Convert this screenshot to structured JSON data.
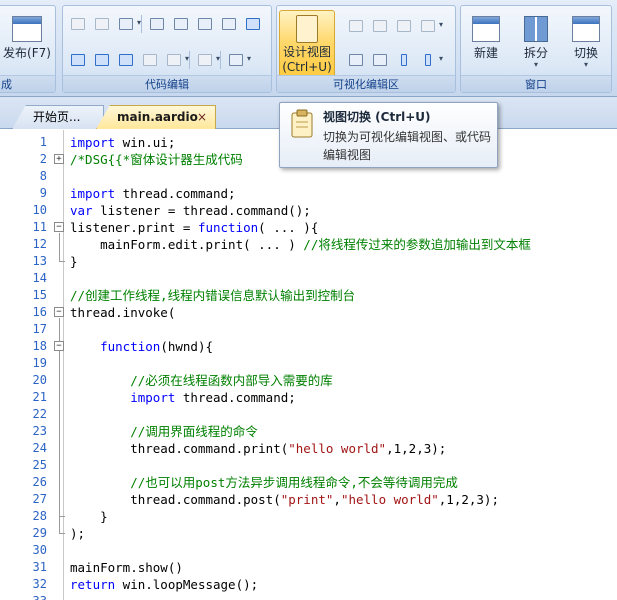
{
  "ribbon": {
    "groups": [
      {
        "title": "成"
      },
      {
        "title": "代码编辑"
      },
      {
        "title": "可视化编辑区"
      },
      {
        "title": "窗口"
      }
    ],
    "publish_label": "发布(F7)",
    "design_view_label": "设计视图",
    "design_view_shortcut": "(Ctrl+U)",
    "new_label": "新建",
    "split_label": "拆分",
    "switch_label": "切换"
  },
  "tabs": [
    {
      "label": "开始页..."
    },
    {
      "label": "main.aardio",
      "close": "×"
    }
  ],
  "tooltip": {
    "title": "视图切换 (Ctrl+U)",
    "description": "切换为可视化编辑视图、或代码编辑视图"
  },
  "editor": {
    "lines": [
      {
        "num": "1",
        "text": "import win.ui;"
      },
      {
        "num": "2",
        "text": "/*DSG{{*窗体设计器生成代码"
      },
      {
        "num": "8",
        "text": ""
      },
      {
        "num": "9",
        "text": "import thread.command;"
      },
      {
        "num": "10",
        "text": "var listener = thread.command();"
      },
      {
        "num": "11",
        "text": "listener.print = function( ... ){"
      },
      {
        "num": "12",
        "text": "    mainForm.edit.print( ... ) //将线程传过来的参数追加输出到文本框"
      },
      {
        "num": "13",
        "text": "}"
      },
      {
        "num": "14",
        "text": ""
      },
      {
        "num": "15",
        "text": "//创建工作线程,线程内错误信息默认输出到控制台"
      },
      {
        "num": "16",
        "text": "thread.invoke("
      },
      {
        "num": "17",
        "text": ""
      },
      {
        "num": "18",
        "text": "    function(hwnd){"
      },
      {
        "num": "19",
        "text": ""
      },
      {
        "num": "20",
        "text": "        //必须在线程函数内部导入需要的库"
      },
      {
        "num": "21",
        "text": "        import thread.command;"
      },
      {
        "num": "22",
        "text": ""
      },
      {
        "num": "23",
        "text": "        //调用界面线程的命令"
      },
      {
        "num": "24",
        "text": "        thread.command.print(\"hello world\",1,2,3);"
      },
      {
        "num": "25",
        "text": ""
      },
      {
        "num": "26",
        "text": "        //也可以用post方法异步调用线程命令,不会等待调用完成"
      },
      {
        "num": "27",
        "text": "        thread.command.post(\"print\",\"hello world\",1,2,3);"
      },
      {
        "num": "28",
        "text": "    }"
      },
      {
        "num": "29",
        "text": ");"
      },
      {
        "num": "30",
        "text": ""
      },
      {
        "num": "31",
        "text": "mainForm.show()"
      },
      {
        "num": "32",
        "text": "return win.loopMessage();"
      },
      {
        "num": "33",
        "text": ""
      }
    ]
  },
  "colors": {
    "keyword": "#0000ff",
    "comment": "#008000",
    "string": "#a31515",
    "line_number": "#2b63c4",
    "active_tab": "#ffe79a"
  }
}
